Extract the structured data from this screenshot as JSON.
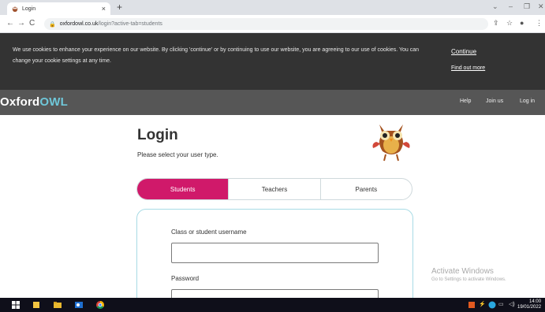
{
  "browser": {
    "tab_title": "Login",
    "tab_close": "×",
    "new_tab": "+",
    "window_controls": [
      "⌄",
      "–",
      "❐",
      "✕"
    ],
    "nav": {
      "back": "←",
      "forward": "→",
      "reload": "C"
    },
    "url_host": "oxfordowl.co.uk",
    "url_path": "/login?active-tab=students",
    "toolbar_icons": [
      "⇪",
      "☆",
      "●",
      "⋮"
    ]
  },
  "cookie_banner": {
    "text": "We use cookies to enhance your experience on our website. By clicking 'continue' or by continuing to use our website, you are agreeing to our use of cookies. You can change your cookie settings at any time.",
    "continue_label": "Continue",
    "find_out_more_label": "Find out more"
  },
  "site_header": {
    "logo_oxford": "Oxford",
    "logo_owl": "OWL",
    "nav": [
      "Help",
      "Join us",
      "Log in"
    ]
  },
  "login": {
    "title": "Login",
    "subtitle": "Please select your user type.",
    "user_types": [
      "Students",
      "Teachers",
      "Parents"
    ],
    "active_user_type": "Students",
    "username_label": "Class or student username",
    "username_value": "",
    "password_label": "Password",
    "password_value": ""
  },
  "watermark": {
    "title": "Activate Windows",
    "subtitle": "Go to Settings to activate Windows."
  },
  "taskbar": {
    "time": "14:00",
    "date": "19/01/2022"
  },
  "colors": {
    "accent": "#d0196a",
    "header_bg": "#565656",
    "cookie_bg": "#333333",
    "owl_blue": "#6fc7d9",
    "card_border": "#a8dbe5"
  }
}
